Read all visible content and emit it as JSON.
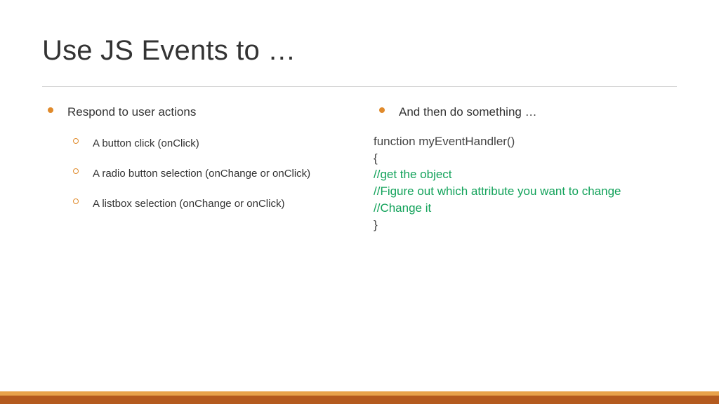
{
  "title": "Use JS Events to …",
  "left": {
    "heading": "Respond to user actions",
    "items": [
      "A button click (onClick)",
      "A radio button selection (onChange or onClick)",
      "A listbox selection (onChange or onClick)"
    ]
  },
  "right": {
    "heading": "And then do something …",
    "code_line1": "function myEventHandler()",
    "code_line2": "{",
    "code_comment1": "  //get the object",
    "code_comment2": "  //Figure out which attribute you want to change",
    "code_comment3": " //Change it",
    "code_line3": "}"
  }
}
